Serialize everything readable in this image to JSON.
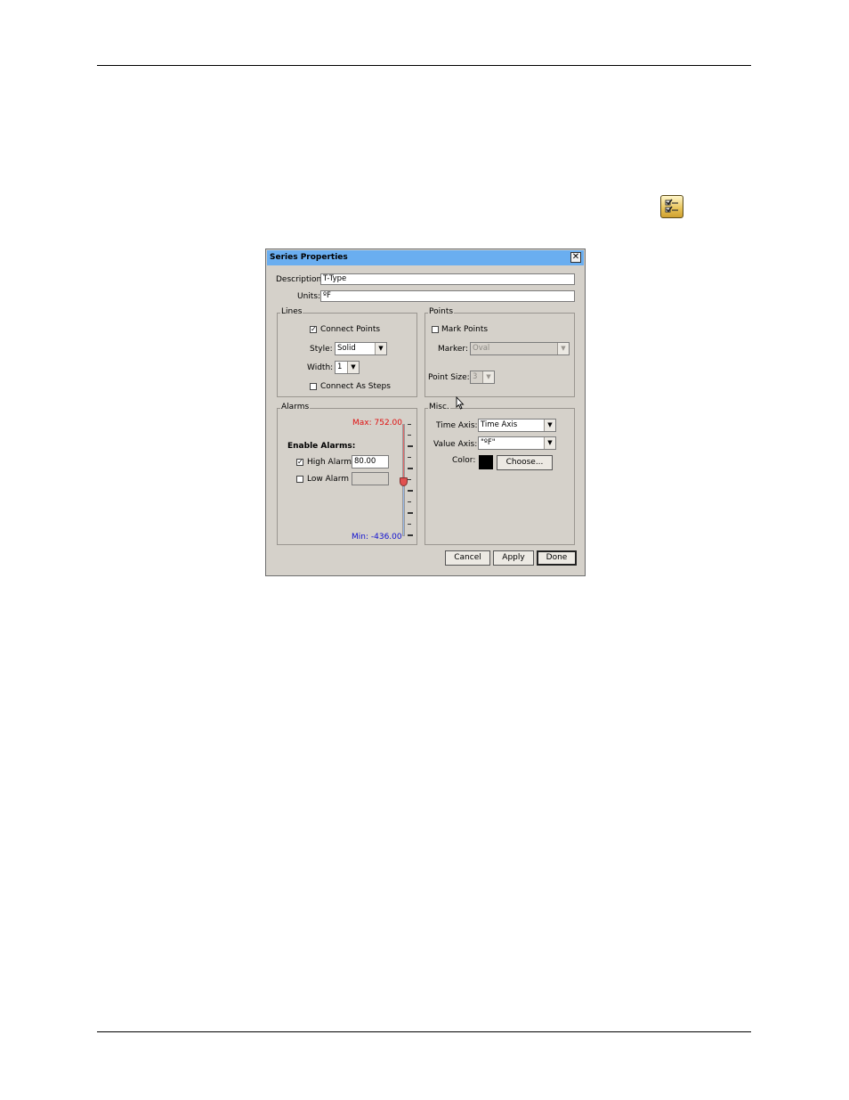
{
  "dialog": {
    "title": "Series Properties",
    "close": "✕",
    "description_label": "Description:",
    "description_value": "T-Type",
    "units_label": "Units:",
    "units_value": "ºF"
  },
  "lines": {
    "legend": "Lines",
    "connect_points_label": "Connect Points",
    "connect_points_checked": true,
    "style_label": "Style:",
    "style_value": "Solid",
    "width_label": "Width:",
    "width_value": "1",
    "connect_steps_label": "Connect As Steps",
    "connect_steps_checked": false
  },
  "points": {
    "legend": "Points",
    "mark_points_label": "Mark Points",
    "mark_points_checked": false,
    "marker_label": "Marker:",
    "marker_value": "Oval",
    "point_size_label": "Point Size:",
    "point_size_value": "3"
  },
  "alarms": {
    "legend": "Alarms",
    "max_text": "Max: 752.00",
    "min_text": "Min: -436.00",
    "enable_label": "Enable Alarms:",
    "high_alarm_label": "High Alarm",
    "high_alarm_checked": true,
    "high_alarm_value": "80.00",
    "low_alarm_label": "Low Alarm",
    "low_alarm_checked": false,
    "low_alarm_value": "",
    "max_color": "#e01010",
    "min_color": "#1010d0"
  },
  "misc": {
    "legend": "Misc.",
    "time_axis_label": "Time Axis:",
    "time_axis_value": "Time Axis",
    "value_axis_label": "Value Axis:",
    "value_axis_value": "\"ºF\"",
    "color_label": "Color:",
    "color_value": "#000000",
    "choose_label": "Choose..."
  },
  "buttons": {
    "cancel": "Cancel",
    "apply": "Apply",
    "done": "Done"
  },
  "icons": {
    "toolbar": "properties-checklist-icon",
    "cursor": "mouse-pointer-icon"
  }
}
